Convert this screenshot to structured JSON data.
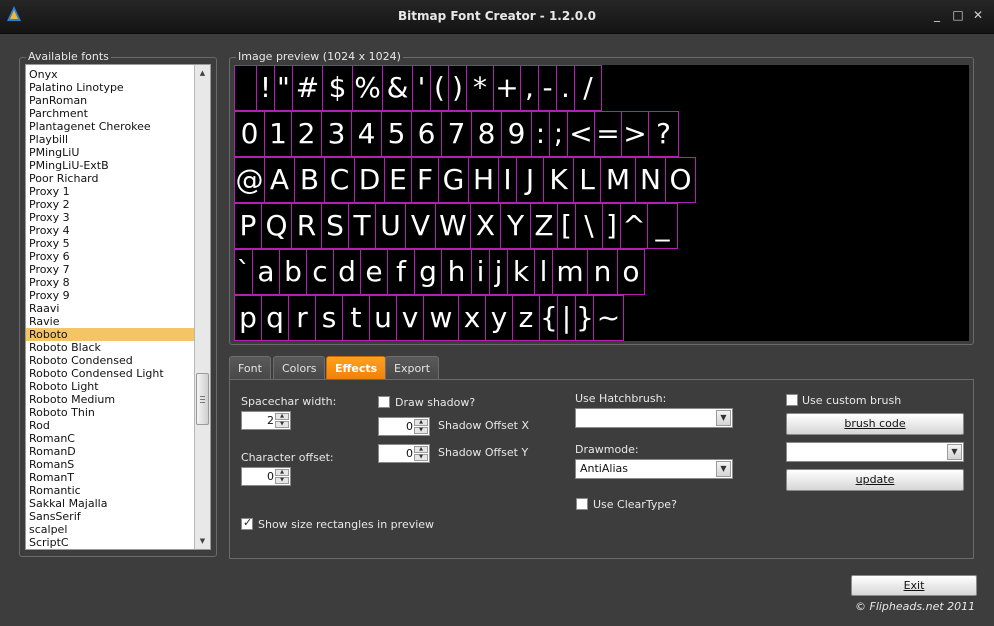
{
  "window": {
    "title": "Bitmap Font Creator - 1.2.0.0",
    "controls": [
      "_",
      "□",
      "✕"
    ]
  },
  "fonts_panel": {
    "title": "Available fonts",
    "items": [
      "Onyx",
      "Palatino Linotype",
      "PanRoman",
      "Parchment",
      "Plantagenet Cherokee",
      "Playbill",
      "PMingLiU",
      "PMingLiU-ExtB",
      "Poor Richard",
      "Proxy 1",
      "Proxy 2",
      "Proxy 3",
      "Proxy 4",
      "Proxy 5",
      "Proxy 6",
      "Proxy 7",
      "Proxy 8",
      "Proxy 9",
      "Raavi",
      "Ravie",
      "Roboto",
      "Roboto Black",
      "Roboto Condensed",
      "Roboto Condensed Light",
      "Roboto Light",
      "Roboto Medium",
      "Roboto Thin",
      "Rod",
      "RomanC",
      "RomanD",
      "RomanS",
      "RomanT",
      "Romantic",
      "Sakkal Majalla",
      "SansSerif",
      "scalpel",
      "ScriptC"
    ],
    "selected": "Roboto"
  },
  "preview": {
    "title": "Image preview (1024 x 1024)",
    "rows": [
      [
        " ",
        "!",
        "\"",
        "#",
        "$",
        "%",
        "&",
        "'",
        "(",
        ")",
        "*",
        "+",
        ",",
        "-",
        ".",
        "/"
      ],
      [
        "0",
        "1",
        "2",
        "3",
        "4",
        "5",
        "6",
        "7",
        "8",
        "9",
        ":",
        ";",
        "<",
        "=",
        ">",
        "?"
      ],
      [
        "@",
        "A",
        "B",
        "C",
        "D",
        "E",
        "F",
        "G",
        "H",
        "I",
        "J",
        "K",
        "L",
        "M",
        "N",
        "O"
      ],
      [
        "P",
        "Q",
        "R",
        "S",
        "T",
        "U",
        "V",
        "W",
        "X",
        "Y",
        "Z",
        "[",
        "\\",
        "]",
        "^",
        "_"
      ],
      [
        "`",
        "a",
        "b",
        "c",
        "d",
        "e",
        "f",
        "g",
        "h",
        "i",
        "j",
        "k",
        "l",
        "m",
        "n",
        "o"
      ],
      [
        "p",
        "q",
        "r",
        "s",
        "t",
        "u",
        "v",
        "w",
        "x",
        "y",
        "z",
        "{",
        "|",
        "}",
        "~"
      ]
    ]
  },
  "tabs": [
    "Font",
    "Colors",
    "Effects",
    "Export"
  ],
  "active_tab": "Effects",
  "effects": {
    "spacechar_label": "Spacechar width:",
    "spacechar_value": "2",
    "char_offset_label": "Character offset:",
    "char_offset_value": "0",
    "draw_shadow_label": "Draw shadow?",
    "draw_shadow_checked": false,
    "shadow_x_label": "Shadow Offset X",
    "shadow_x_value": "0",
    "shadow_y_label": "Shadow Offset Y",
    "shadow_y_value": "0",
    "show_rects_label": "Show size rectangles in preview",
    "show_rects_checked": true,
    "hatchbrush_label": "Use Hatchbrush:",
    "hatchbrush_value": "",
    "drawmode_label": "Drawmode:",
    "drawmode_value": "AntiAlias",
    "cleartype_label": "Use ClearType?",
    "cleartype_checked": false,
    "custom_brush_label": "Use custom brush",
    "custom_brush_checked": false,
    "brush_code_button": "brush code",
    "brush_combo_value": "",
    "update_button": "update"
  },
  "footer": {
    "exit_button": "Exit",
    "copyright": "© Flipheads.net 2011"
  },
  "colors": {
    "accent_tab": "#f28a10",
    "glyph_box": "#b21fb2",
    "selected_item": "#f3c565"
  }
}
